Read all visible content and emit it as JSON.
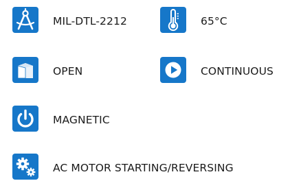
{
  "specs": [
    {
      "icon": "drafting-compass-icon",
      "label": "MIL-DTL-2212"
    },
    {
      "icon": "thermometer-icon",
      "label": "65°C"
    },
    {
      "icon": "enclosure-box-icon",
      "label": "OPEN"
    },
    {
      "icon": "play-icon",
      "label": "CONTINUOUS"
    },
    {
      "icon": "power-icon",
      "label": "MAGNETIC"
    },
    {
      "icon": "gears-icon",
      "label": "AC MOTOR STARTING/REVERSING"
    }
  ],
  "colors": {
    "icon_tile": "#1677c9",
    "text": "#1a1a1a"
  }
}
